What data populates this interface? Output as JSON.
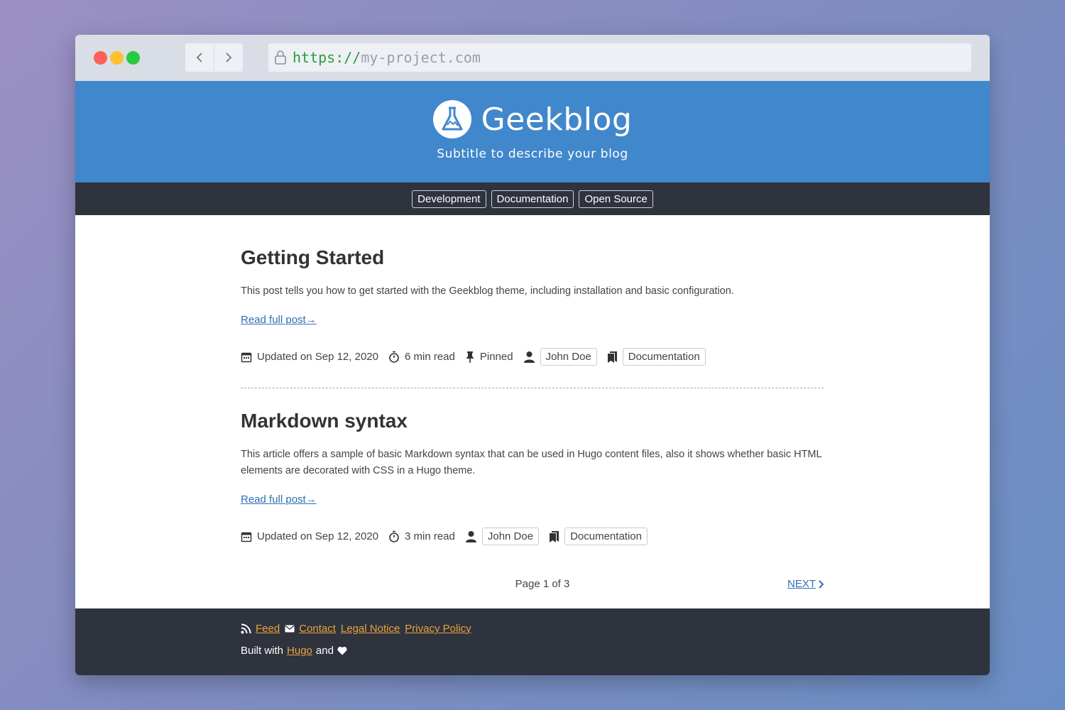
{
  "browser": {
    "url_scheme": "https://",
    "url_host": "my-project.com"
  },
  "header": {
    "title": "Geekblog",
    "subtitle": "Subtitle to describe your blog"
  },
  "menu": [
    "Development",
    "Documentation",
    "Open Source"
  ],
  "posts": [
    {
      "title": "Getting Started",
      "excerpt": "This post tells you how to get started with the Geekblog theme, including installation and basic configuration.",
      "read_more": "Read full post",
      "updated": "Updated on Sep 12, 2020",
      "read_time": "6 min read",
      "pinned": "Pinned",
      "author": "John Doe",
      "tag": "Documentation"
    },
    {
      "title": "Markdown syntax",
      "excerpt": "This article offers a sample of basic Markdown syntax that can be used in Hugo content files, also it shows whether basic HTML elements are decorated with CSS in a Hugo theme.",
      "read_more": "Read full post",
      "updated": "Updated on Sep 12, 2020",
      "read_time": "3 min read",
      "author": "John Doe",
      "tag": "Documentation"
    }
  ],
  "pagination": {
    "page_text": "Page 1 of 3",
    "next_label": "NEXT"
  },
  "footer": {
    "feed": "Feed",
    "contact": "Contact",
    "legal": "Legal Notice",
    "privacy": "Privacy Policy",
    "built_with": "Built with",
    "hugo": "Hugo",
    "and": "and"
  },
  "colors": {
    "header_bg": "#4187cb",
    "menu_bg": "#2f333e",
    "link": "#2f6eb5",
    "footer_link": "#e9a23b"
  },
  "icons": [
    "lock-icon",
    "back-arrow-icon",
    "forward-arrow-icon",
    "flask-logo-icon",
    "calendar-icon",
    "timer-icon",
    "pin-icon",
    "person-icon",
    "bookmarks-icon",
    "rss-icon",
    "mail-icon",
    "heart-icon",
    "chevron-right-icon"
  ]
}
